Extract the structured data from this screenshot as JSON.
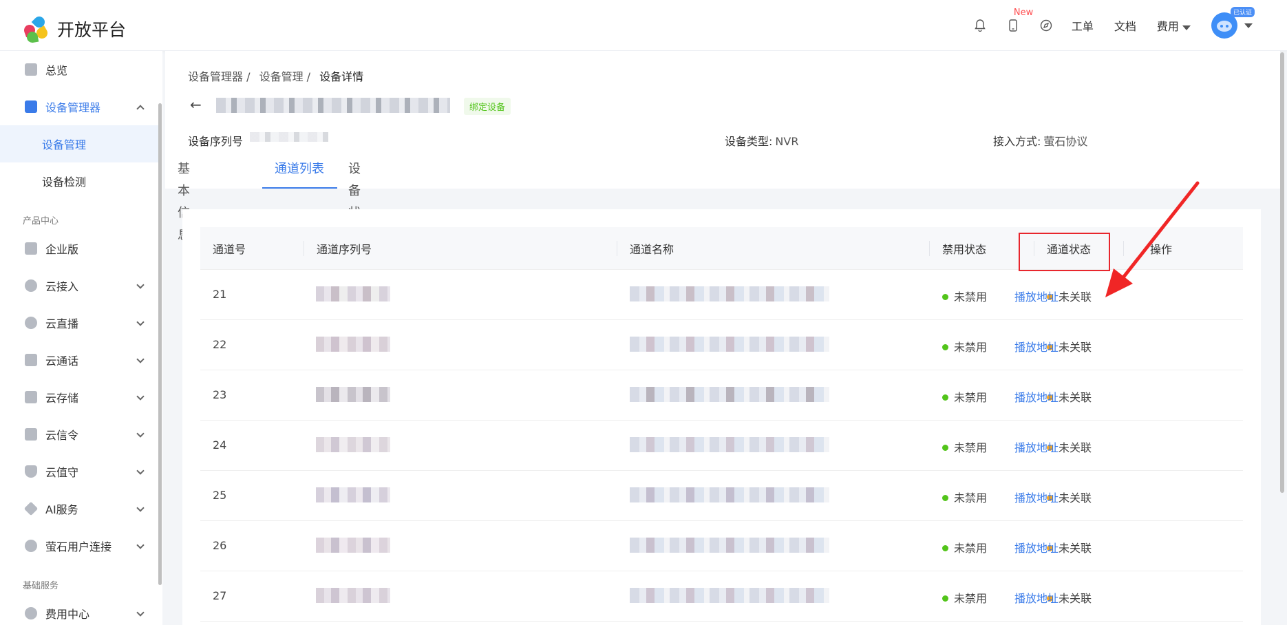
{
  "header": {
    "logo_text": "开放平台",
    "new_badge": "New",
    "links": [
      "工单",
      "文档",
      "费用"
    ],
    "avatar_badge": "已认证"
  },
  "sidebar": {
    "overview": "总览",
    "device_manager": "设备管理器",
    "device_management": "设备管理",
    "device_check": "设备检测",
    "section_product": "产品中心",
    "enterprise": "企业版",
    "cloud_access": "云接入",
    "cloud_live": "云直播",
    "cloud_call": "云通话",
    "cloud_storage": "云存储",
    "cloud_signal": "云信令",
    "cloud_guard": "云值守",
    "ai_service": "AI服务",
    "ys_user": "萤石用户连接",
    "section_basic": "基础服务",
    "billing": "费用中心"
  },
  "breadcrumb": [
    "设备管理器 /",
    "设备管理 /",
    "设备详情"
  ],
  "device": {
    "bind_tag": "绑定设备",
    "serial_label": "设备序列号",
    "type_label": "设备类型:",
    "type_value": "NVR",
    "access_label": "接入方式:",
    "access_value": "萤石协议"
  },
  "tabs": [
    "基本信息",
    "通道列表",
    "设备状态"
  ],
  "table": {
    "headers": [
      "通道号",
      "通道序列号",
      "通道名称",
      "禁用状态",
      "通道状态",
      "操作"
    ],
    "rows": [
      {
        "no": "21",
        "disabled": "未禁用",
        "status": "未关联",
        "op": "播放地址"
      },
      {
        "no": "22",
        "disabled": "未禁用",
        "status": "未关联",
        "op": "播放地址"
      },
      {
        "no": "23",
        "disabled": "未禁用",
        "status": "未关联",
        "op": "播放地址"
      },
      {
        "no": "24",
        "disabled": "未禁用",
        "status": "未关联",
        "op": "播放地址"
      },
      {
        "no": "25",
        "disabled": "未禁用",
        "status": "未关联",
        "op": "播放地址"
      },
      {
        "no": "26",
        "disabled": "未禁用",
        "status": "未关联",
        "op": "播放地址"
      },
      {
        "no": "27",
        "disabled": "未禁用",
        "status": "未关联",
        "op": "播放地址"
      }
    ]
  },
  "colors": {
    "accent": "#3a7be9",
    "highlight": "#e8262d",
    "enabled_dot": "#52c41a",
    "status_dot": "#f5a623"
  }
}
